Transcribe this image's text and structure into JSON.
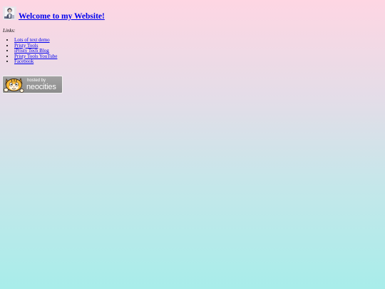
{
  "header": {
    "avatar_icon": "person-avatar-icon",
    "title": "Welcome to my Website!"
  },
  "links": {
    "label": "Links:",
    "items": [
      {
        "label": "Lots of text demo"
      },
      {
        "label": "Pristy Tools"
      },
      {
        "label": "iPristy Tech Blog"
      },
      {
        "label": "Pristy Tools YouTube"
      },
      {
        "label": "Facebook"
      }
    ]
  },
  "badge": {
    "icon": "neocities-cat-icon",
    "hosted_by": "hosted by",
    "name": "neocities"
  },
  "colors": {
    "background_top": "#fed6e3",
    "background_bottom": "#a8edea",
    "link": "#0000ee",
    "badge_bg": "#979797"
  }
}
